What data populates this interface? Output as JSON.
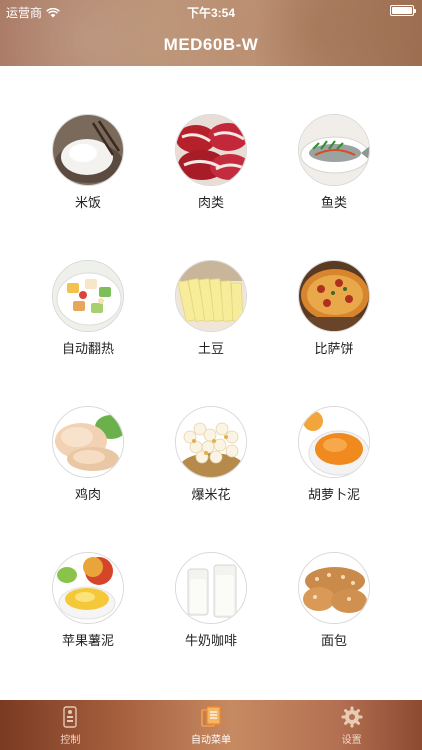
{
  "status": {
    "carrier": "运营商",
    "time": "下午3:54"
  },
  "header": {
    "title": "MED60B-W"
  },
  "menu": {
    "items": [
      {
        "label": "米饭",
        "icon": "rice-image"
      },
      {
        "label": "肉类",
        "icon": "meat-image"
      },
      {
        "label": "鱼类",
        "icon": "fish-image"
      },
      {
        "label": "自动翻热",
        "icon": "reheat-image"
      },
      {
        "label": "土豆",
        "icon": "potato-image"
      },
      {
        "label": "比萨饼",
        "icon": "pizza-image"
      },
      {
        "label": "鸡肉",
        "icon": "chicken-image"
      },
      {
        "label": "爆米花",
        "icon": "popcorn-image"
      },
      {
        "label": "胡萝卜泥",
        "icon": "carrot-puree-image"
      },
      {
        "label": "苹果薯泥",
        "icon": "apple-puree-image"
      },
      {
        "label": "牛奶咖啡",
        "icon": "milk-coffee-image"
      },
      {
        "label": "面包",
        "icon": "bread-image"
      }
    ]
  },
  "tabbar": {
    "tabs": [
      {
        "label": "控制",
        "icon": "remote-icon",
        "active": false
      },
      {
        "label": "自动菜单",
        "icon": "menu-book-icon",
        "active": true
      },
      {
        "label": "设置",
        "icon": "gear-icon",
        "active": false
      }
    ]
  }
}
